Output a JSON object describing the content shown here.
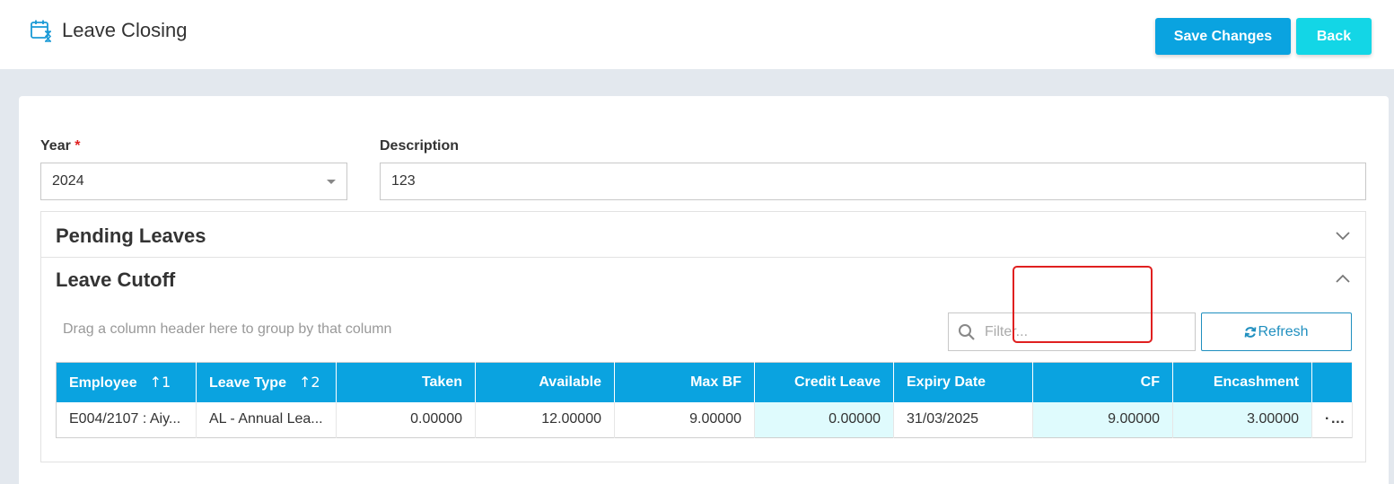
{
  "header": {
    "title": "Leave Closing",
    "save_label": "Save Changes",
    "back_label": "Back"
  },
  "form": {
    "year_label": "Year",
    "year_required_mark": "*",
    "year_value": "2024",
    "description_label": "Description",
    "description_value": "123"
  },
  "pending_panel": {
    "title": "Pending Leaves"
  },
  "cutoff_panel": {
    "title": "Leave Cutoff",
    "group_hint": "Drag a column header here to group by that column",
    "filter_placeholder": "Filter...",
    "refresh_label": "Refresh"
  },
  "grid": {
    "columns": [
      {
        "label": "Employee",
        "sort": "↑1"
      },
      {
        "label": "Leave Type",
        "sort": "↑2"
      },
      {
        "label": "Taken"
      },
      {
        "label": "Available"
      },
      {
        "label": "Max BF"
      },
      {
        "label": "Credit Leave"
      },
      {
        "label": "Expiry Date"
      },
      {
        "label": "CF"
      },
      {
        "label": "Encashment"
      }
    ],
    "rows": [
      {
        "employee": "E004/2107 : Aiy...",
        "leave_type": "AL - Annual Lea...",
        "taken": "0.00000",
        "available": "12.00000",
        "max_bf": "9.00000",
        "credit_leave": "0.00000",
        "expiry_date": "31/03/2025",
        "cf": "9.00000",
        "encashment": "3.00000",
        "more": "···"
      }
    ]
  },
  "colors": {
    "primary": "#0aa3e0",
    "back_button": "#13d6e6",
    "editable_cell": "#dffbfd",
    "highlight": "#e02020"
  },
  "icons": {
    "title": "calendar-hourglass-icon",
    "pending_toggle": "chevron-down-icon",
    "cutoff_toggle": "chevron-up-icon",
    "filter": "search-icon",
    "refresh": "refresh-icon"
  }
}
